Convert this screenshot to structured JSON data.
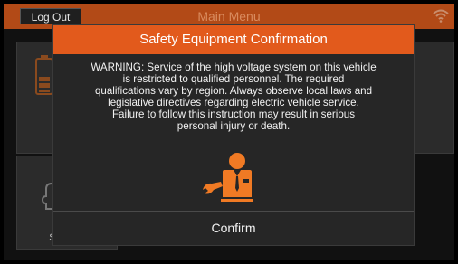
{
  "topbar": {
    "logout_label": "Log Out",
    "title": "Main Menu"
  },
  "tiles": {
    "battery_label_line1": "M",
    "battery_label_line2": "Ba",
    "service_label": "Se"
  },
  "modal": {
    "title": "Safety Equipment Confirmation",
    "warning_lines": [
      "WARNING: Service of the high voltage system on this vehicle",
      "is restricted to qualified personnel. The required",
      "qualifications vary by region. Always observe local laws and",
      "legislative directives regarding electric vehicle service.",
      "Failure to follow this instruction may result in serious",
      "personal injury or death."
    ],
    "confirm_label": "Confirm",
    "icon": "technician-with-wrench-icon"
  },
  "colors": {
    "accent": "#e25a1c",
    "topbar": "#b24a17"
  }
}
